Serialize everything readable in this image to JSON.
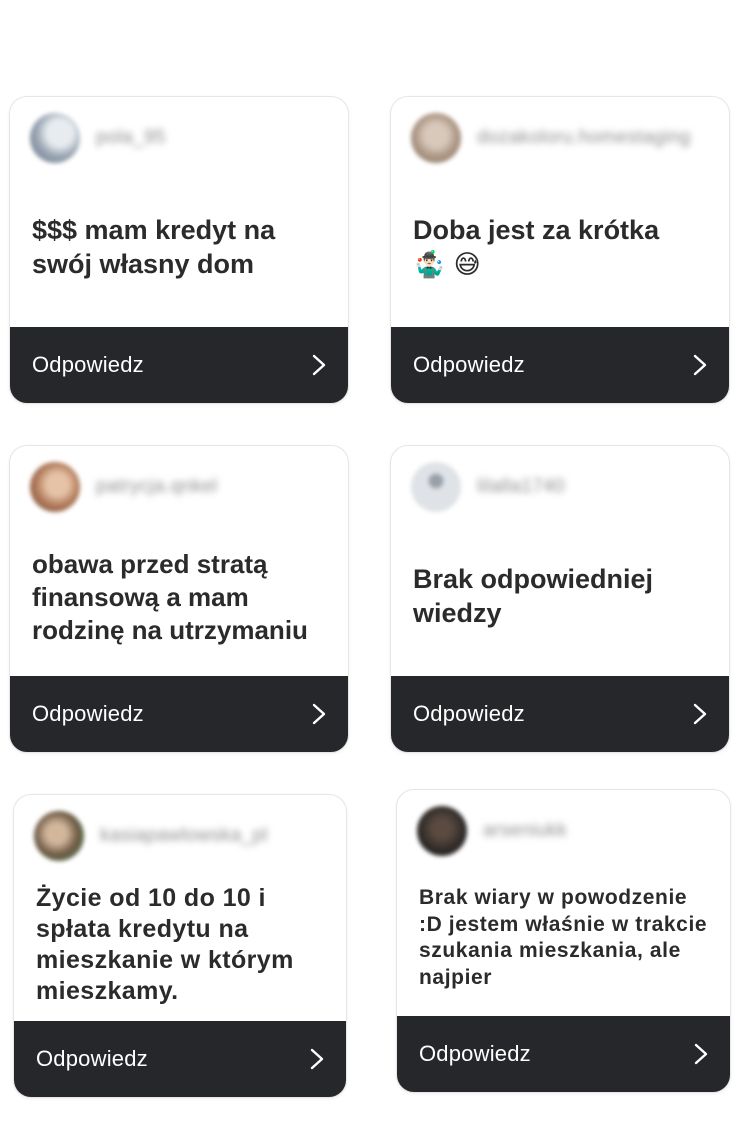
{
  "reply_label": "Odpowiedz",
  "cards": [
    {
      "username": "pola_95",
      "avatar_color": "#9aa6b3",
      "question": "$$$ mam kredyt na swój własny dom",
      "emoji": ""
    },
    {
      "username": "dozakoloru.homestaging",
      "avatar_color": "#b09a88",
      "question": "Doba jest za krótka",
      "emoji": "🤹🏻‍♂️ 😅"
    },
    {
      "username": "patrycja.qnkel",
      "avatar_color": "#b07a5a",
      "question": "obawa przed stratą finansową a mam rodzinę na utrzymaniu",
      "emoji": ""
    },
    {
      "username": "lilalla1740",
      "avatar_color": "#c8ccd2",
      "question": "Brak odpowiedniej wiedzy",
      "emoji": ""
    },
    {
      "username": "kasiapawlowska_pl",
      "avatar_color": "#8a7560",
      "question": "Życie od 10 do 10 i spłata kredytu na mieszkanie w którym mieszkamy.",
      "emoji": ""
    },
    {
      "username": "arseniukk",
      "avatar_color": "#2e2a28",
      "question": "Brak wiary w powodzenie :D jestem właśnie w trakcie szukania mieszkania, ale najpier",
      "emoji": ""
    }
  ]
}
